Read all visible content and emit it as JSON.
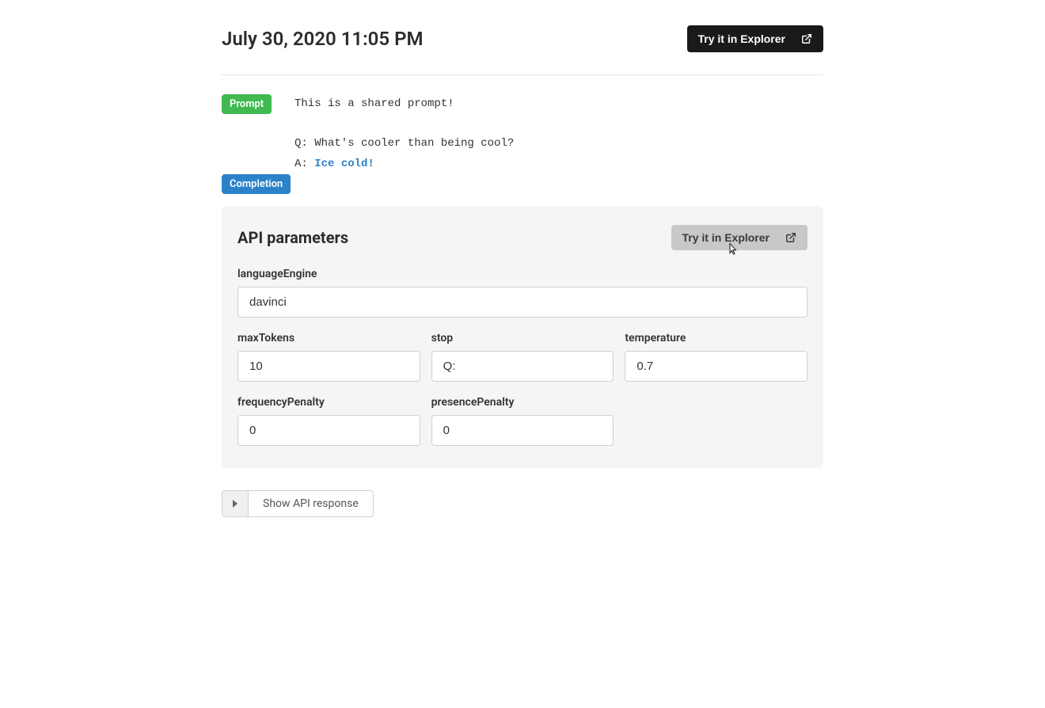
{
  "header": {
    "timestamp": "July 30, 2020 11:05 PM",
    "try_button": "Try it in Explorer"
  },
  "labels": {
    "prompt": "Prompt",
    "completion": "Completion"
  },
  "prompt": {
    "line1": "This is a shared prompt!",
    "line2": "Q: What's cooler than being cool?",
    "line3_prefix": "A: ",
    "completion": "Ice cold!"
  },
  "api": {
    "title": "API parameters",
    "try_button": "Try it in Explorer",
    "fields": {
      "languageEngine": {
        "label": "languageEngine",
        "value": "davinci"
      },
      "maxTokens": {
        "label": "maxTokens",
        "value": "10"
      },
      "stop": {
        "label": "stop",
        "value": "Q:"
      },
      "temperature": {
        "label": "temperature",
        "value": "0.7"
      },
      "frequencyPenalty": {
        "label": "frequencyPenalty",
        "value": "0"
      },
      "presencePenalty": {
        "label": "presencePenalty",
        "value": "0"
      }
    }
  },
  "show_response": "Show API response"
}
